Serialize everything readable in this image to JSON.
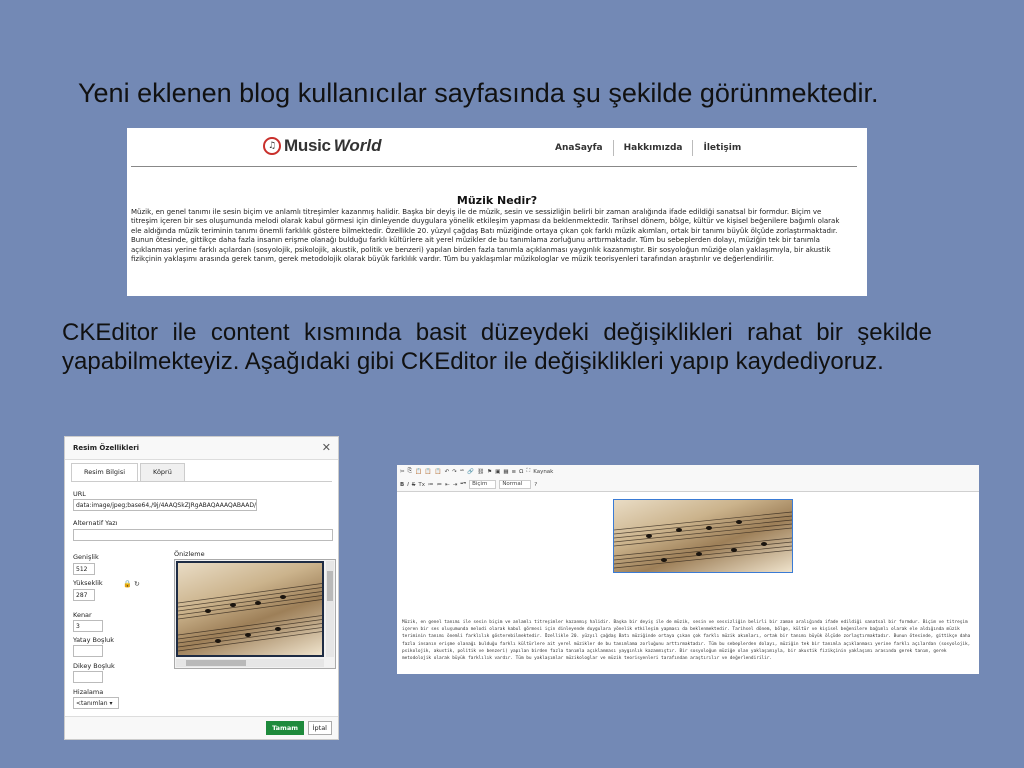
{
  "slide": {
    "heading": "Yeni eklenen blog kullanıcılar sayfasında şu şekilde görünmektedir.",
    "paragraph": "CKEditor ile content kısmında basit düzeydeki değişiklikleri rahat bir şekilde yapabilmekteyiz. Aşağıdaki gibi CKEditor ile değişiklikleri yapıp kaydediyoruz.",
    "background_color": "#7389b5"
  },
  "site": {
    "logo_music": "Music",
    "logo_world": "World",
    "logo_icon": "vinyl-disc-icon",
    "nav": [
      "AnaSayfa",
      "Hakkımızda",
      "İletişim"
    ],
    "title": "Müzik Nedir?",
    "text": "Müzik, en genel tanımı ile sesin biçim ve anlamlı titreşimler kazanmış halidir. Başka bir deyiş ile de müzik, sesin ve sessizliğin belirli bir zaman aralığında ifade edildiği sanatsal bir formdur. Biçim ve titreşim içeren bir ses oluşumunda melodi olarak kabul görmesi için dinleyende duygulara yönelik etkileşim yapması da beklenmektedir. Tarihsel dönem, bölge, kültür ve kişisel beğenilere bağımlı olarak ele aldığında müzik teriminin tanımı önemli farklılık göstere bilmektedir. Özellikle 20. yüzyıl çağdaş Batı müziğinde ortaya çıkan çok farklı müzik akımları, ortak bir tanımı büyük ölçüde zorlaştırmaktadır. Bunun ötesinde, gittikçe daha fazla insanın erişme olanağı bulduğu farklı kültürlere ait yerel müzikler de bu tanımlama zorluğunu arttırmaktadır. Tüm bu sebeplerden dolayı, müziğin tek bir tanımla açıklanması yerine farklı açılardan (sosyolojik, psikolojik, akustik, politik ve benzeri) yapılan birden fazla tanımla açıklanması yaygınlık kazanmıştır. Bir sosyoloğun müziğe olan yaklaşımıyla, bir akustik fizikçinin yaklaşımı arasında gerek tanım, gerek metodolojik olarak büyük farklılık vardır. Tüm bu yaklaşımlar müzikologlar ve müzik teorisyenleri tarafından araştırılır ve değerlendirilir."
  },
  "dialog": {
    "title": "Resim Özellikleri",
    "tabs": [
      "Resim Bilgisi",
      "Köprü"
    ],
    "url_label": "URL",
    "url_value": "data:image/jpeg;base64,/9j/4AAQSkZJRgABAQAAAQABAAD/2",
    "alt_label": "Alternatif Yazı",
    "alt_value": "",
    "width_label": "Genişlik",
    "width_value": "512",
    "height_label": "Yükseklik",
    "height_value": "287",
    "border_label": "Kenar",
    "border_value": "3",
    "hspace_label": "Yatay Boşluk",
    "vspace_label": "Dikey Boşluk",
    "align_label": "Hizalama",
    "align_value": "<tanımlan",
    "preview_label": "Önizleme",
    "ok": "Tamam",
    "cancel": "İptal"
  },
  "editor": {
    "toolbar_row1": [
      "✂",
      "⎘",
      "📋",
      "📋",
      "📋",
      "↶",
      "↷",
      "ᵃᵇ",
      "🔗",
      "⛓",
      "⚑",
      "▣",
      "▦",
      "≡",
      "Ω",
      "⛶",
      "Kaynak"
    ],
    "toolbar_row2": [
      "B",
      "I",
      "S",
      "Tx",
      "≔",
      "≔",
      "⇤",
      "⇥",
      "❝❞",
      "Biçim",
      "Normal",
      "?"
    ],
    "format_value": "Biçim",
    "style_value": "Normal",
    "source_label": "Kaynak",
    "text": "Müzik, en genel tanımı ile sesin biçim ve anlamlı titreşimler kazanmış halidir. Başka bir deyiş ile de müzik, sesin ve sessizliğin belirli bir zaman aralığında ifade edildiği sanatsal bir formdur. Biçim ve titreşim içeren bir ses oluşumunda melodi olarak kabul görmesi için dinleyende duygulara yönelik etkileşim yapması da beklenmektedir. Tarihsel dönem, bölge, kültür ve kişisel beğenilere bağımlı olarak ele aldığında müzik teriminin tanımı önemli farklılık gösterebilmektedir. Özellikle 20. yüzyıl çağdaş Batı müziğinde ortaya çıkan çok farklı müzik akımları, ortak bir tanımı büyük ölçüde zorlaştırmaktadır. Bunun ötesinde, gittikçe daha fazla insanın erişme olanağı bulduğu farklı kültürlere ait yerel müzikler de bu tanımlama zorluğunu arttırmaktadır. Tüm bu sebeplerden dolayı, müziğin tek bir tanımla açıklanması yerine farklı açılardan (sosyolojik, psikolojik, akustik, politik ve benzeri) yapılan birden fazla tanımla açıklanması yaygınlık kazanmıştır. Bir sosyoloğun müziğe olan yaklaşımıyla, bir akustik fizikçinin yaklaşımı arasında gerek tanım, gerek metodolojik olarak büyük farklılık vardır. Tüm bu yaklaşımlar müzikologlar ve müzik teorisyenleri tarafından araştırılır ve değerlendirilir."
  }
}
